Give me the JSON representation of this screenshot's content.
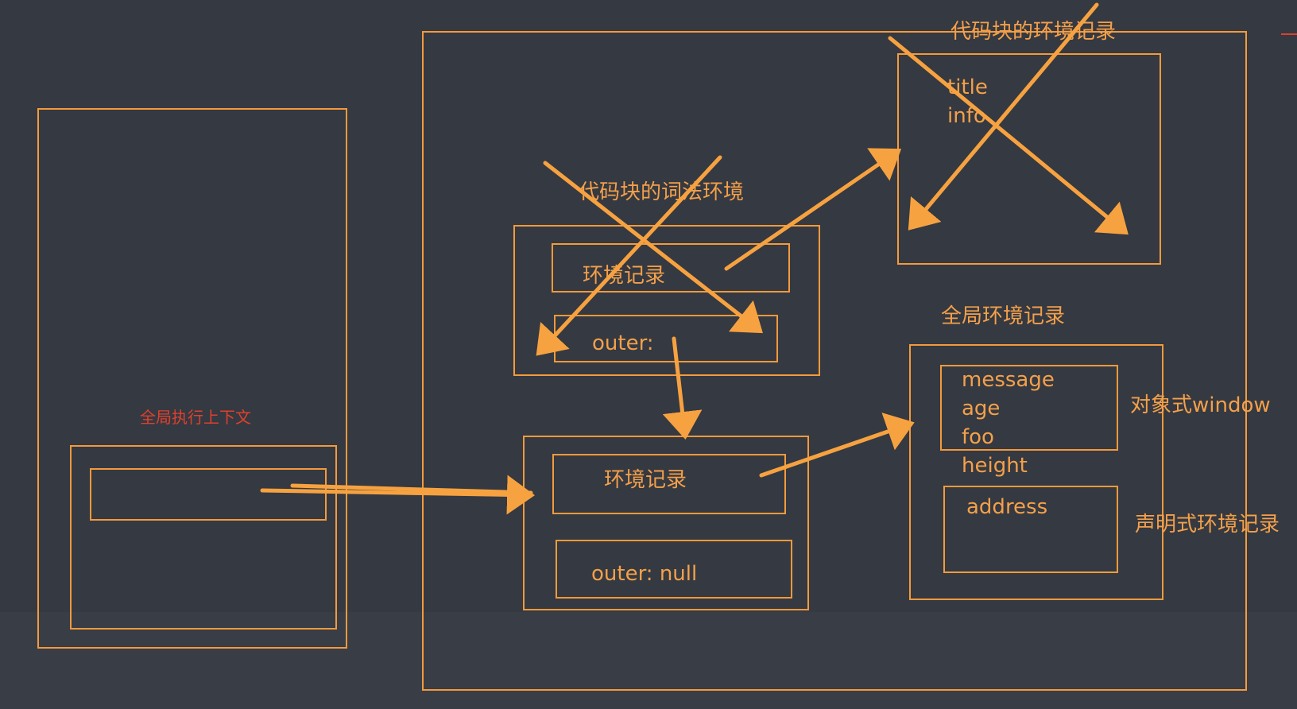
{
  "labels": {
    "global_exec_context": "全局执行上下文",
    "block_env_record_title": "代码块的环境记录",
    "block_record_var1": "title",
    "block_record_var2": "info",
    "block_lexical_env": "代码块的词法环境",
    "block_env_record": "环境记录",
    "block_outer": "outer:",
    "global_env_record": "环境记录",
    "global_outer": "outer: null",
    "global_env_record_title": "全局环境记录",
    "obj_var1": "message",
    "obj_var2": "age",
    "obj_var3": "foo",
    "obj_var4": "height",
    "object_env_label": "对象式window",
    "decl_var1": "address",
    "declarative_env_label": "声明式环境记录"
  },
  "colors": {
    "background": "#353941",
    "accent": "#f49a3c",
    "arrow": "#f7a240",
    "red_text": "#e0402e"
  }
}
